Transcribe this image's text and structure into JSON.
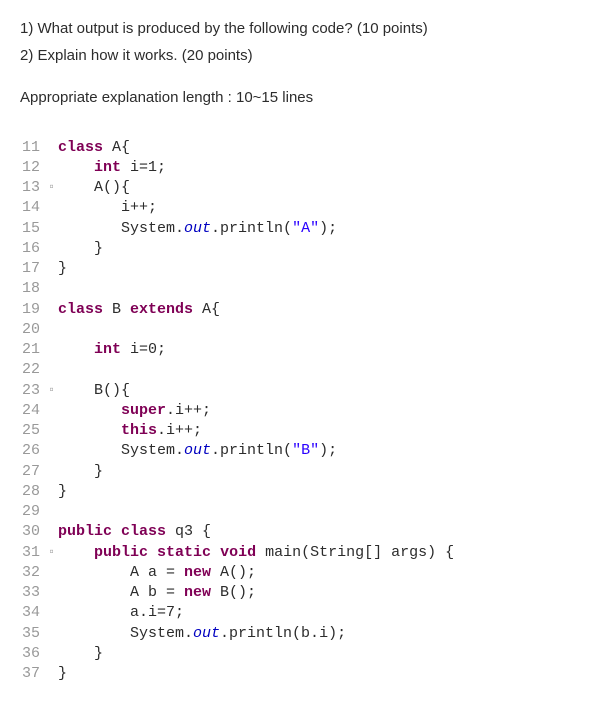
{
  "questions": {
    "q1": "1) What output is produced by the following code? (10 points)",
    "q2": "2) Explain how it works. (20 points)"
  },
  "note": "Appropriate explanation length : 10~15 lines",
  "code": [
    {
      "n": "11",
      "mark": "",
      "tokens": [
        {
          "c": "kw",
          "t": "class"
        },
        {
          "c": "",
          "t": " A{"
        }
      ]
    },
    {
      "n": "12",
      "mark": "",
      "tokens": [
        {
          "c": "",
          "t": "    "
        },
        {
          "c": "kw",
          "t": "int"
        },
        {
          "c": "",
          "t": " i=1;"
        }
      ]
    },
    {
      "n": "13",
      "mark": "▫",
      "tokens": [
        {
          "c": "",
          "t": "    A(){"
        }
      ]
    },
    {
      "n": "14",
      "mark": "",
      "tokens": [
        {
          "c": "",
          "t": "       i++;"
        }
      ]
    },
    {
      "n": "15",
      "mark": "",
      "tokens": [
        {
          "c": "",
          "t": "       System."
        },
        {
          "c": "field-static",
          "t": "out"
        },
        {
          "c": "",
          "t": ".println("
        },
        {
          "c": "str",
          "t": "\"A\""
        },
        {
          "c": "",
          "t": ");"
        }
      ]
    },
    {
      "n": "16",
      "mark": "",
      "tokens": [
        {
          "c": "",
          "t": "    }"
        }
      ]
    },
    {
      "n": "17",
      "mark": "",
      "tokens": [
        {
          "c": "",
          "t": "}"
        }
      ]
    },
    {
      "n": "18",
      "mark": "",
      "tokens": [
        {
          "c": "",
          "t": ""
        }
      ]
    },
    {
      "n": "19",
      "mark": "",
      "tokens": [
        {
          "c": "kw",
          "t": "class"
        },
        {
          "c": "",
          "t": " B "
        },
        {
          "c": "kw",
          "t": "extends"
        },
        {
          "c": "",
          "t": " A{"
        }
      ]
    },
    {
      "n": "20",
      "mark": "",
      "tokens": [
        {
          "c": "",
          "t": ""
        }
      ]
    },
    {
      "n": "21",
      "mark": "",
      "tokens": [
        {
          "c": "",
          "t": "    "
        },
        {
          "c": "kw",
          "t": "int"
        },
        {
          "c": "",
          "t": " i=0;"
        }
      ]
    },
    {
      "n": "22",
      "mark": "",
      "tokens": [
        {
          "c": "",
          "t": ""
        }
      ]
    },
    {
      "n": "23",
      "mark": "▫",
      "tokens": [
        {
          "c": "",
          "t": "    B(){"
        }
      ]
    },
    {
      "n": "24",
      "mark": "",
      "tokens": [
        {
          "c": "",
          "t": "       "
        },
        {
          "c": "kw",
          "t": "super"
        },
        {
          "c": "",
          "t": ".i++;"
        }
      ]
    },
    {
      "n": "25",
      "mark": "",
      "tokens": [
        {
          "c": "",
          "t": "       "
        },
        {
          "c": "kw",
          "t": "this"
        },
        {
          "c": "",
          "t": ".i++;"
        }
      ]
    },
    {
      "n": "26",
      "mark": "",
      "tokens": [
        {
          "c": "",
          "t": "       System."
        },
        {
          "c": "field-static",
          "t": "out"
        },
        {
          "c": "",
          "t": ".println("
        },
        {
          "c": "str",
          "t": "\"B\""
        },
        {
          "c": "",
          "t": ");"
        }
      ]
    },
    {
      "n": "27",
      "mark": "",
      "tokens": [
        {
          "c": "",
          "t": "    }"
        }
      ]
    },
    {
      "n": "28",
      "mark": "",
      "tokens": [
        {
          "c": "",
          "t": "}"
        }
      ]
    },
    {
      "n": "29",
      "mark": "",
      "tokens": [
        {
          "c": "",
          "t": ""
        }
      ]
    },
    {
      "n": "30",
      "mark": "",
      "tokens": [
        {
          "c": "kw",
          "t": "public"
        },
        {
          "c": "",
          "t": " "
        },
        {
          "c": "kw",
          "t": "class"
        },
        {
          "c": "",
          "t": " q3 {"
        }
      ]
    },
    {
      "n": "31",
      "mark": "▫",
      "tokens": [
        {
          "c": "",
          "t": "    "
        },
        {
          "c": "kw",
          "t": "public"
        },
        {
          "c": "",
          "t": " "
        },
        {
          "c": "kw",
          "t": "static"
        },
        {
          "c": "",
          "t": " "
        },
        {
          "c": "kw",
          "t": "void"
        },
        {
          "c": "",
          "t": " main(String[] args) {"
        }
      ]
    },
    {
      "n": "32",
      "mark": "",
      "tokens": [
        {
          "c": "",
          "t": "        A a = "
        },
        {
          "c": "kw",
          "t": "new"
        },
        {
          "c": "",
          "t": " A();"
        }
      ]
    },
    {
      "n": "33",
      "mark": "",
      "tokens": [
        {
          "c": "",
          "t": "        A b = "
        },
        {
          "c": "kw",
          "t": "new"
        },
        {
          "c": "",
          "t": " B();"
        }
      ]
    },
    {
      "n": "34",
      "mark": "",
      "tokens": [
        {
          "c": "",
          "t": "        a.i=7;"
        }
      ]
    },
    {
      "n": "35",
      "mark": "",
      "tokens": [
        {
          "c": "",
          "t": "        System."
        },
        {
          "c": "field-static",
          "t": "out"
        },
        {
          "c": "",
          "t": ".println(b.i);"
        }
      ]
    },
    {
      "n": "36",
      "mark": "",
      "tokens": [
        {
          "c": "",
          "t": "    }"
        }
      ]
    },
    {
      "n": "37",
      "mark": "",
      "tokens": [
        {
          "c": "",
          "t": "}"
        }
      ]
    }
  ]
}
